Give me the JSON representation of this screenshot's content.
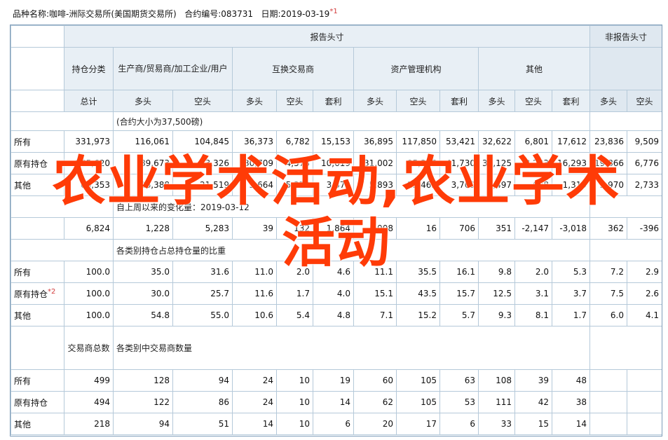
{
  "top": {
    "product_label": "品种名称:咖啡-洲际交易所(美国期货交易所)",
    "code_label": "合约编号:083731",
    "date_label": "日期:2019-03-19",
    "footnote_mark": "*1"
  },
  "headers": {
    "reported": "报告头寸",
    "nonreported": "非报告头寸",
    "category": "持仓分类",
    "producer": "生产商/贸易商/加工企业/用户",
    "swap": "互换交易商",
    "managed": "资产管理机构",
    "other": "其他",
    "total": "总计",
    "long": "多头",
    "short": "空头",
    "spread": "套利"
  },
  "contract_note": "(合约大小为37,500磅)",
  "change_note": "自上周以来的变化量：2019-03-12",
  "pct_note": "各类别持仓占总持仓量的比重",
  "traders_label": "交易商总数",
  "traders_note": "各类别中交易商数量",
  "row_labels": {
    "all": "所有",
    "old": "原有持仓",
    "oth": "其他"
  },
  "footnote2": "*2",
  "positions": [
    [
      "所有",
      "331,973",
      "116,061",
      "104,845",
      "36,373",
      "6,782",
      "15,153",
      "36,895",
      "117,850",
      "53,421",
      "32,622",
      "6,801",
      "17,612",
      "23,836",
      "9,509"
    ],
    [
      "原有持仓",
      "265,620",
      "89,673",
      "83,326",
      "30,709",
      "4,573",
      "10,619",
      "31,002",
      "95,385",
      "41,730",
      "30,125",
      "8,233",
      "16,293",
      "19,866",
      "6,776"
    ],
    [
      "其他",
      "66,353",
      "26,388",
      "21,519",
      "5,664",
      "5,370",
      "3,372",
      "5,893",
      "22,465",
      "3,769",
      "2,497",
      "628",
      "1,319",
      "3,970",
      "2,733"
    ]
  ],
  "changes": [
    "6,824",
    "1,228",
    "5,283",
    "39",
    "132",
    "1,864",
    "908",
    "16",
    "706",
    "351",
    "-2,147",
    "-3,018",
    "362",
    "-396"
  ],
  "percents": [
    [
      "所有",
      "100.0",
      "35.0",
      "31.6",
      "11.0",
      "2.0",
      "4.6",
      "11.1",
      "35.5",
      "16.1",
      "9.8",
      "2.0",
      "5.3",
      "7.2",
      "2.9"
    ],
    [
      "原有持仓",
      "100.0",
      "30.0",
      "25.7",
      "11.6",
      "1.7",
      "4.0",
      "15.1",
      "43.5",
      "15.7",
      "12.5",
      "3.1",
      "3.7",
      "7.5",
      "2.6"
    ],
    [
      "其他",
      "100.0",
      "54.8",
      "55.0",
      "10.6",
      "5.4",
      "4.8",
      "7.1",
      "15.2",
      "5.7",
      "9.3",
      "8.1",
      "1.7",
      "6.0",
      "4.1"
    ]
  ],
  "traders": [
    [
      "所有",
      "499",
      "128",
      "94",
      "24",
      "10",
      "19",
      "60",
      "105",
      "63",
      "108",
      "39",
      "48",
      "",
      ""
    ],
    [
      "原有持仓",
      "494",
      "122",
      "86",
      "24",
      "10",
      "14",
      "62",
      "105",
      "53",
      "111",
      "42",
      "38",
      "",
      ""
    ],
    [
      "其他",
      "218",
      "94",
      "51",
      "14",
      "10",
      "6",
      "20",
      "17",
      "6",
      "33",
      "15",
      "14",
      "",
      ""
    ]
  ],
  "watermark": "农业学术活动,农业学术活动",
  "colors": {
    "header_bg": "#e8eff5",
    "border": "#b5c9d9",
    "watermark": "#ff3b07",
    "footnote": "#d23c3c"
  }
}
